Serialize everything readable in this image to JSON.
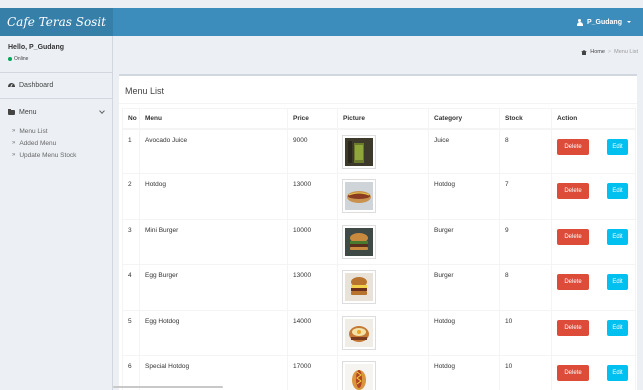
{
  "app": {
    "brand": "Cafe Teras Sosit"
  },
  "header": {
    "user_label": "P_Gudang"
  },
  "sidebar": {
    "greeting": "Hello, P_Gudang",
    "status": "Online",
    "dashboard_label": "Dashboard",
    "menu_label": "Menu",
    "submenu": [
      {
        "label": "Menu List"
      },
      {
        "label": "Added Menu"
      },
      {
        "label": "Update Menu Stock"
      }
    ]
  },
  "breadcrumb": {
    "home": "Home",
    "current": "Menu List"
  },
  "box": {
    "title": "Menu List"
  },
  "table": {
    "headers": [
      "No",
      "Menu",
      "Price",
      "Picture",
      "Category",
      "Stock",
      "Action"
    ],
    "delete_label": "Delete",
    "edit_label": "Edit",
    "rows": [
      {
        "no": "1",
        "menu": "Avocado Juice",
        "price": "9000",
        "category": "Juice",
        "stock": "8"
      },
      {
        "no": "2",
        "menu": "Hotdog",
        "price": "13000",
        "category": "Hotdog",
        "stock": "7"
      },
      {
        "no": "3",
        "menu": "Mini Burger",
        "price": "10000",
        "category": "Burger",
        "stock": "9"
      },
      {
        "no": "4",
        "menu": "Egg Burger",
        "price": "13000",
        "category": "Burger",
        "stock": "8"
      },
      {
        "no": "5",
        "menu": "Egg Hotdog",
        "price": "14000",
        "category": "Hotdog",
        "stock": "10"
      },
      {
        "no": "6",
        "menu": "Special Hotdog",
        "price": "17000",
        "category": "Hotdog",
        "stock": "10"
      }
    ]
  },
  "colors": {
    "header_bg": "#3c8dbc",
    "brand_bg": "#367fa9",
    "delete_button": "#dd4b39",
    "edit_button": "#00c0ef",
    "online_dot": "#00a65a"
  }
}
